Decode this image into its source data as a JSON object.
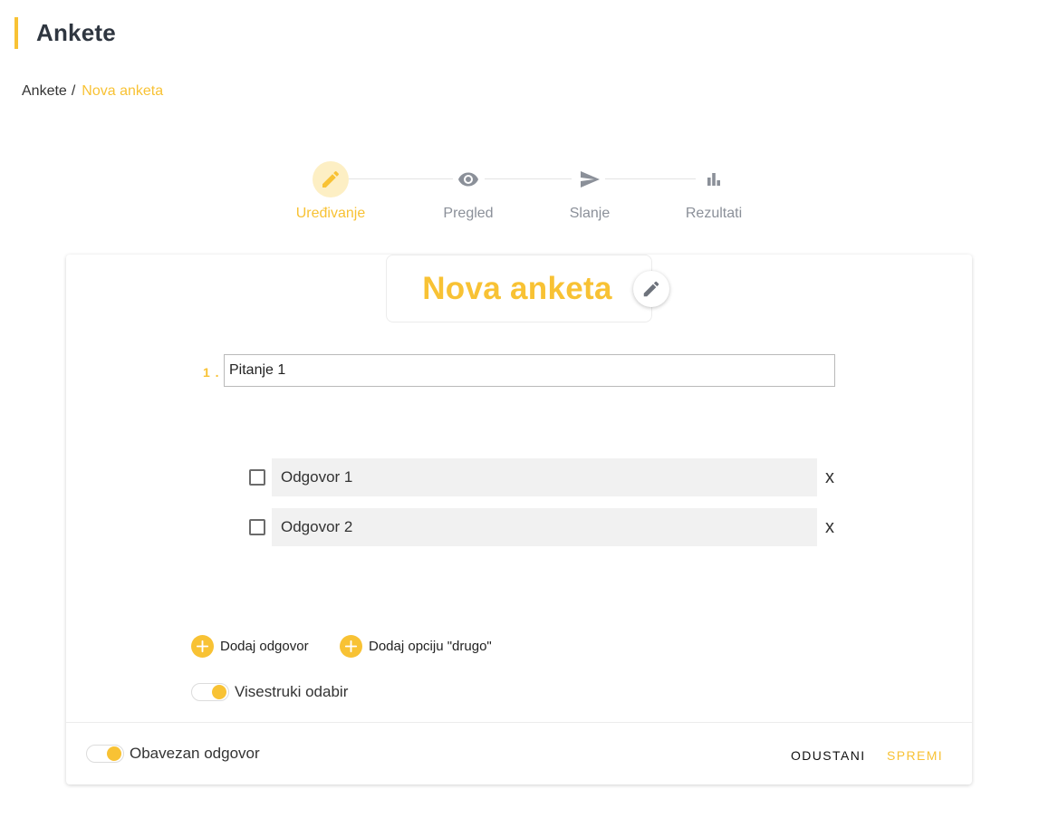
{
  "header": {
    "title": "Ankete"
  },
  "breadcrumb": {
    "root": "Ankete",
    "separator": "/",
    "current": "Nova anketa"
  },
  "stepper": {
    "steps": [
      {
        "label": "Uređivanje",
        "icon": "pencil-icon",
        "active": true
      },
      {
        "label": "Pregled",
        "icon": "eye-icon",
        "active": false
      },
      {
        "label": "Slanje",
        "icon": "send-icon",
        "active": false
      },
      {
        "label": "Rezultati",
        "icon": "bar-chart-icon",
        "active": false
      }
    ]
  },
  "survey": {
    "title": "Nova anketa",
    "question": {
      "number": "1 .",
      "value": "Pitanje 1"
    },
    "answers": [
      {
        "value": "Odgovor 1",
        "checked": false,
        "remove_label": "x"
      },
      {
        "value": "Odgovor 2",
        "checked": false,
        "remove_label": "x"
      }
    ],
    "add_answer_label": "Dodaj odgovor",
    "add_other_label": "Dodaj opciju \"drugo\"",
    "multiple_choice": {
      "label": "Visestruki odabir",
      "on": true
    },
    "required_answer": {
      "label": "Obavezan odgovor",
      "on": true
    }
  },
  "actions": {
    "cancel_label": "ODUSTANI",
    "save_label": "SPREMI"
  },
  "colors": {
    "accent": "#f8c234",
    "accent_light": "#fdefc4",
    "muted": "#8b9099"
  }
}
